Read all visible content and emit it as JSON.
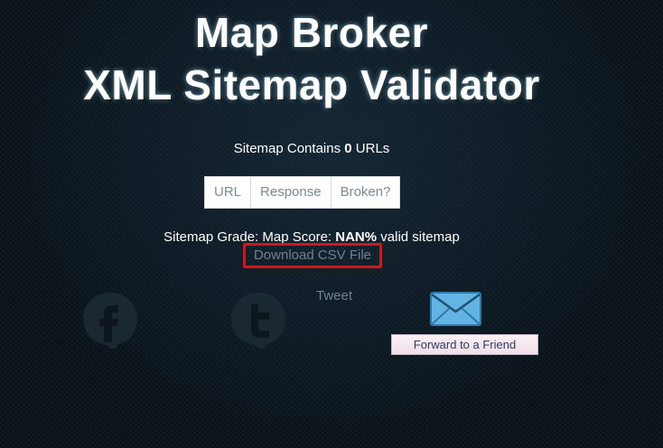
{
  "header": {
    "title_line1": "Map Broker",
    "title_line2": "XML Sitemap Validator"
  },
  "summary": {
    "prefix": "Sitemap Contains ",
    "count": "0",
    "suffix": " URLs"
  },
  "table": {
    "columns": [
      "URL",
      "Response",
      "Broken?"
    ]
  },
  "grade": {
    "prefix": "Sitemap Grade: Map Score: ",
    "value": "NAN%",
    "suffix": " valid sitemap"
  },
  "links": {
    "download_csv": "Download CSV File",
    "tweet": "Tweet",
    "forward": "Forward to a Friend"
  },
  "icons": {
    "facebook": "facebook-icon",
    "twitter": "twitter-icon",
    "email": "envelope-icon"
  },
  "colors": {
    "highlight_border": "#d11717",
    "link_text": "#6e8291",
    "envelope": "#5fb0e0"
  }
}
